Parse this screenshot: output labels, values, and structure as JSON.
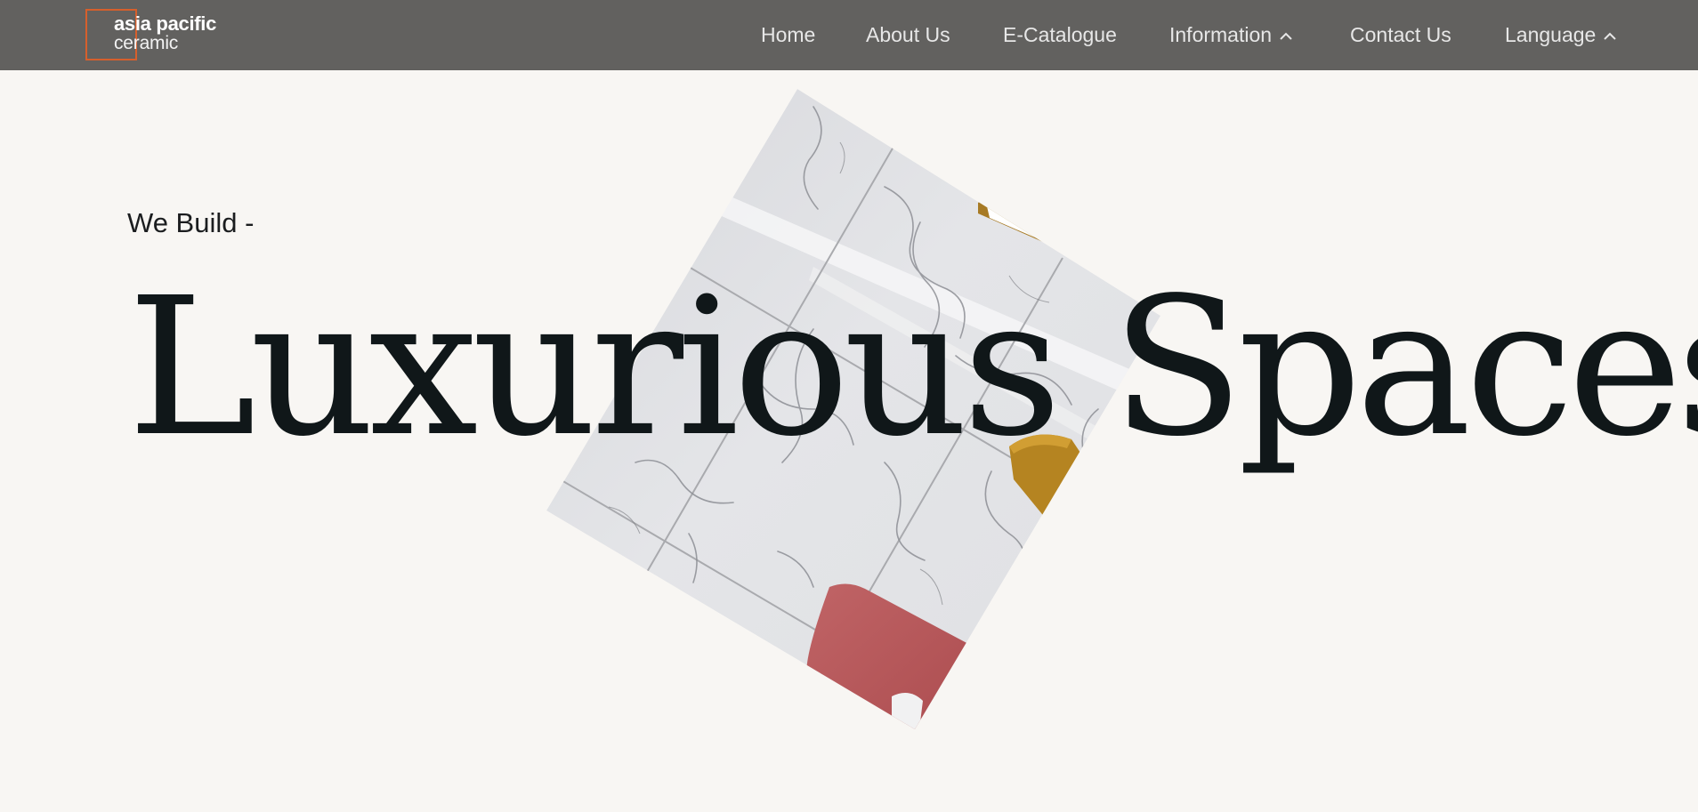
{
  "brand": {
    "name_line1": "asia pacific",
    "name_line2": "ceramic",
    "accent_color": "#d65f2c",
    "header_bg": "#62615f"
  },
  "nav": {
    "items": [
      {
        "label": "Home",
        "has_dropdown": false
      },
      {
        "label": "About Us",
        "has_dropdown": false
      },
      {
        "label": "E-Catalogue",
        "has_dropdown": false
      },
      {
        "label": "Information",
        "has_dropdown": true,
        "icon": "chevron-up-icon"
      },
      {
        "label": "Contact Us",
        "has_dropdown": false
      },
      {
        "label": "Language",
        "has_dropdown": true,
        "icon": "chevron-up-icon"
      }
    ]
  },
  "hero": {
    "eyebrow": "We Build -",
    "headline": "Luxurious Spaces",
    "background": "#f8f6f3",
    "image_subject": "marble-tile-floor-photo"
  }
}
